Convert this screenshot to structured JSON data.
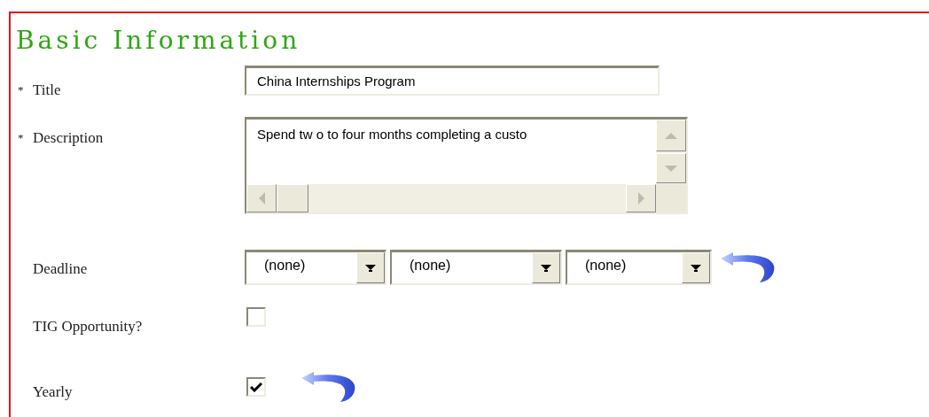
{
  "heading": "Basic Information",
  "fields": [
    {
      "kind": "text",
      "marker": "*",
      "label": "Title",
      "value": "China Internships Program"
    },
    {
      "kind": "textarea",
      "marker": "*",
      "label": "Description",
      "value": "Spend tw o to four months completing a custo"
    },
    {
      "kind": "selects",
      "label": "Deadline",
      "options": [
        "(none)",
        "(none)",
        "(none)"
      ],
      "reset_icon": true
    },
    {
      "kind": "checkbox",
      "label": "TIG Opportunity?",
      "checked": false,
      "reset_icon": false
    },
    {
      "kind": "checkbox",
      "label": "Yearly",
      "checked": true,
      "reset_icon": true
    }
  ]
}
